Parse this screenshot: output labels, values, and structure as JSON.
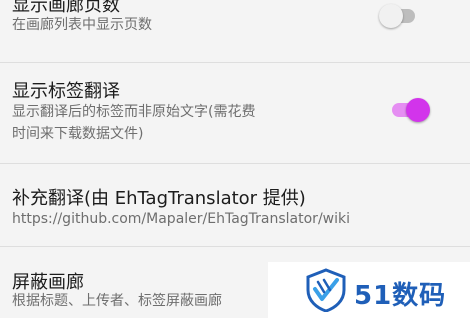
{
  "settings": {
    "show_gallery_pages": {
      "title": "显示画廊页数",
      "summary": "在画廊列表中显示页数",
      "enabled": false
    },
    "show_tag_translation": {
      "title": "显示标签翻译",
      "summary_line1": "显示翻译后的标签而非原始文字(需花费",
      "summary_line2": "时间来下载数据文件)",
      "enabled": true
    },
    "supplement_translation": {
      "title": "补充翻译(由 EhTagTranslator 提供)",
      "summary": "https://github.com/Mapaler/EhTagTranslator/wiki"
    },
    "block_gallery": {
      "title": "屏蔽画廊",
      "summary": "根据标题、上传者、标签屏蔽画廊"
    }
  },
  "watermark": {
    "text": "51数码"
  },
  "colors": {
    "accent": "#d234eb",
    "accent_track": "#e58ef2",
    "switch_off_track": "#bdbdbd",
    "watermark_blue": "#1f5fb8"
  }
}
